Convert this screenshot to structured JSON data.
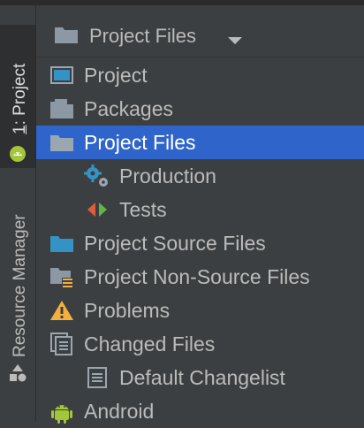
{
  "toolwindows": {
    "project_number": "1",
    "project_label": ": Project",
    "resource_manager_label": "Resource Manager"
  },
  "header": {
    "title": "Project Files"
  },
  "tree": {
    "items": [
      {
        "label": "Project",
        "icon": "project-view-icon"
      },
      {
        "label": "Packages",
        "icon": "packages-folder-icon"
      },
      {
        "label": "Project Files",
        "icon": "folder-icon"
      },
      {
        "label": "Production",
        "icon": "gears-icon"
      },
      {
        "label": "Tests",
        "icon": "tests-arrows-icon"
      },
      {
        "label": "Project Source Files",
        "icon": "source-folder-icon"
      },
      {
        "label": "Project Non-Source Files",
        "icon": "non-source-folder-icon"
      },
      {
        "label": "Problems",
        "icon": "warning-icon"
      },
      {
        "label": "Changed Files",
        "icon": "changed-files-icon"
      },
      {
        "label": "Default Changelist",
        "icon": "changelist-icon"
      },
      {
        "label": "Android",
        "icon": "android-icon"
      }
    ],
    "selected_index": 2
  },
  "colors": {
    "selection": "#2f65ca",
    "background": "#3c3f41",
    "text": "#bbbbbb",
    "folder": "#8c98a3",
    "source_folder": "#3592c4",
    "warning": "#f4af3d",
    "android": "#a4c639",
    "gear": "#3592c4"
  }
}
